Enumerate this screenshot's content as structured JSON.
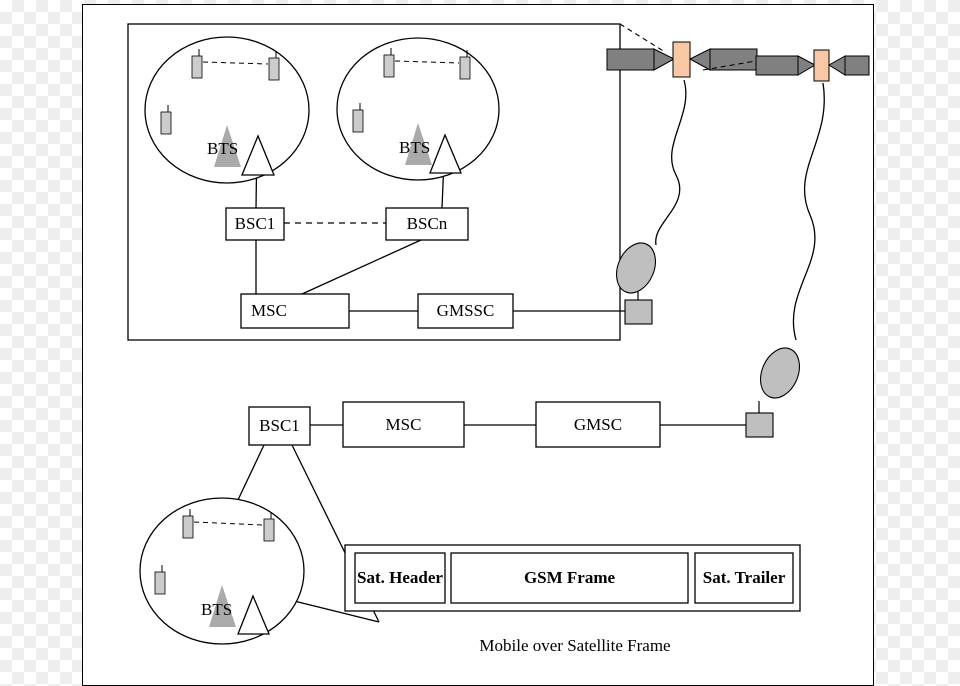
{
  "labels": {
    "bts_top_left": "BTS",
    "bts_top_right": "BTS",
    "bts_bottom": "BTS",
    "bsc1_top": "BSC1",
    "bscn_top": "BSCn",
    "msc_top": "MSC",
    "gmssc_top": "GMSSC",
    "bsc1_mid": "BSC1",
    "msc_mid": "MSC",
    "gmsc_mid": "GMSC",
    "sat_header": "Sat. Header",
    "gsm_frame": "GSM Frame",
    "sat_trailer": "Sat. Trailer",
    "caption": "Mobile over Satellite Frame"
  }
}
